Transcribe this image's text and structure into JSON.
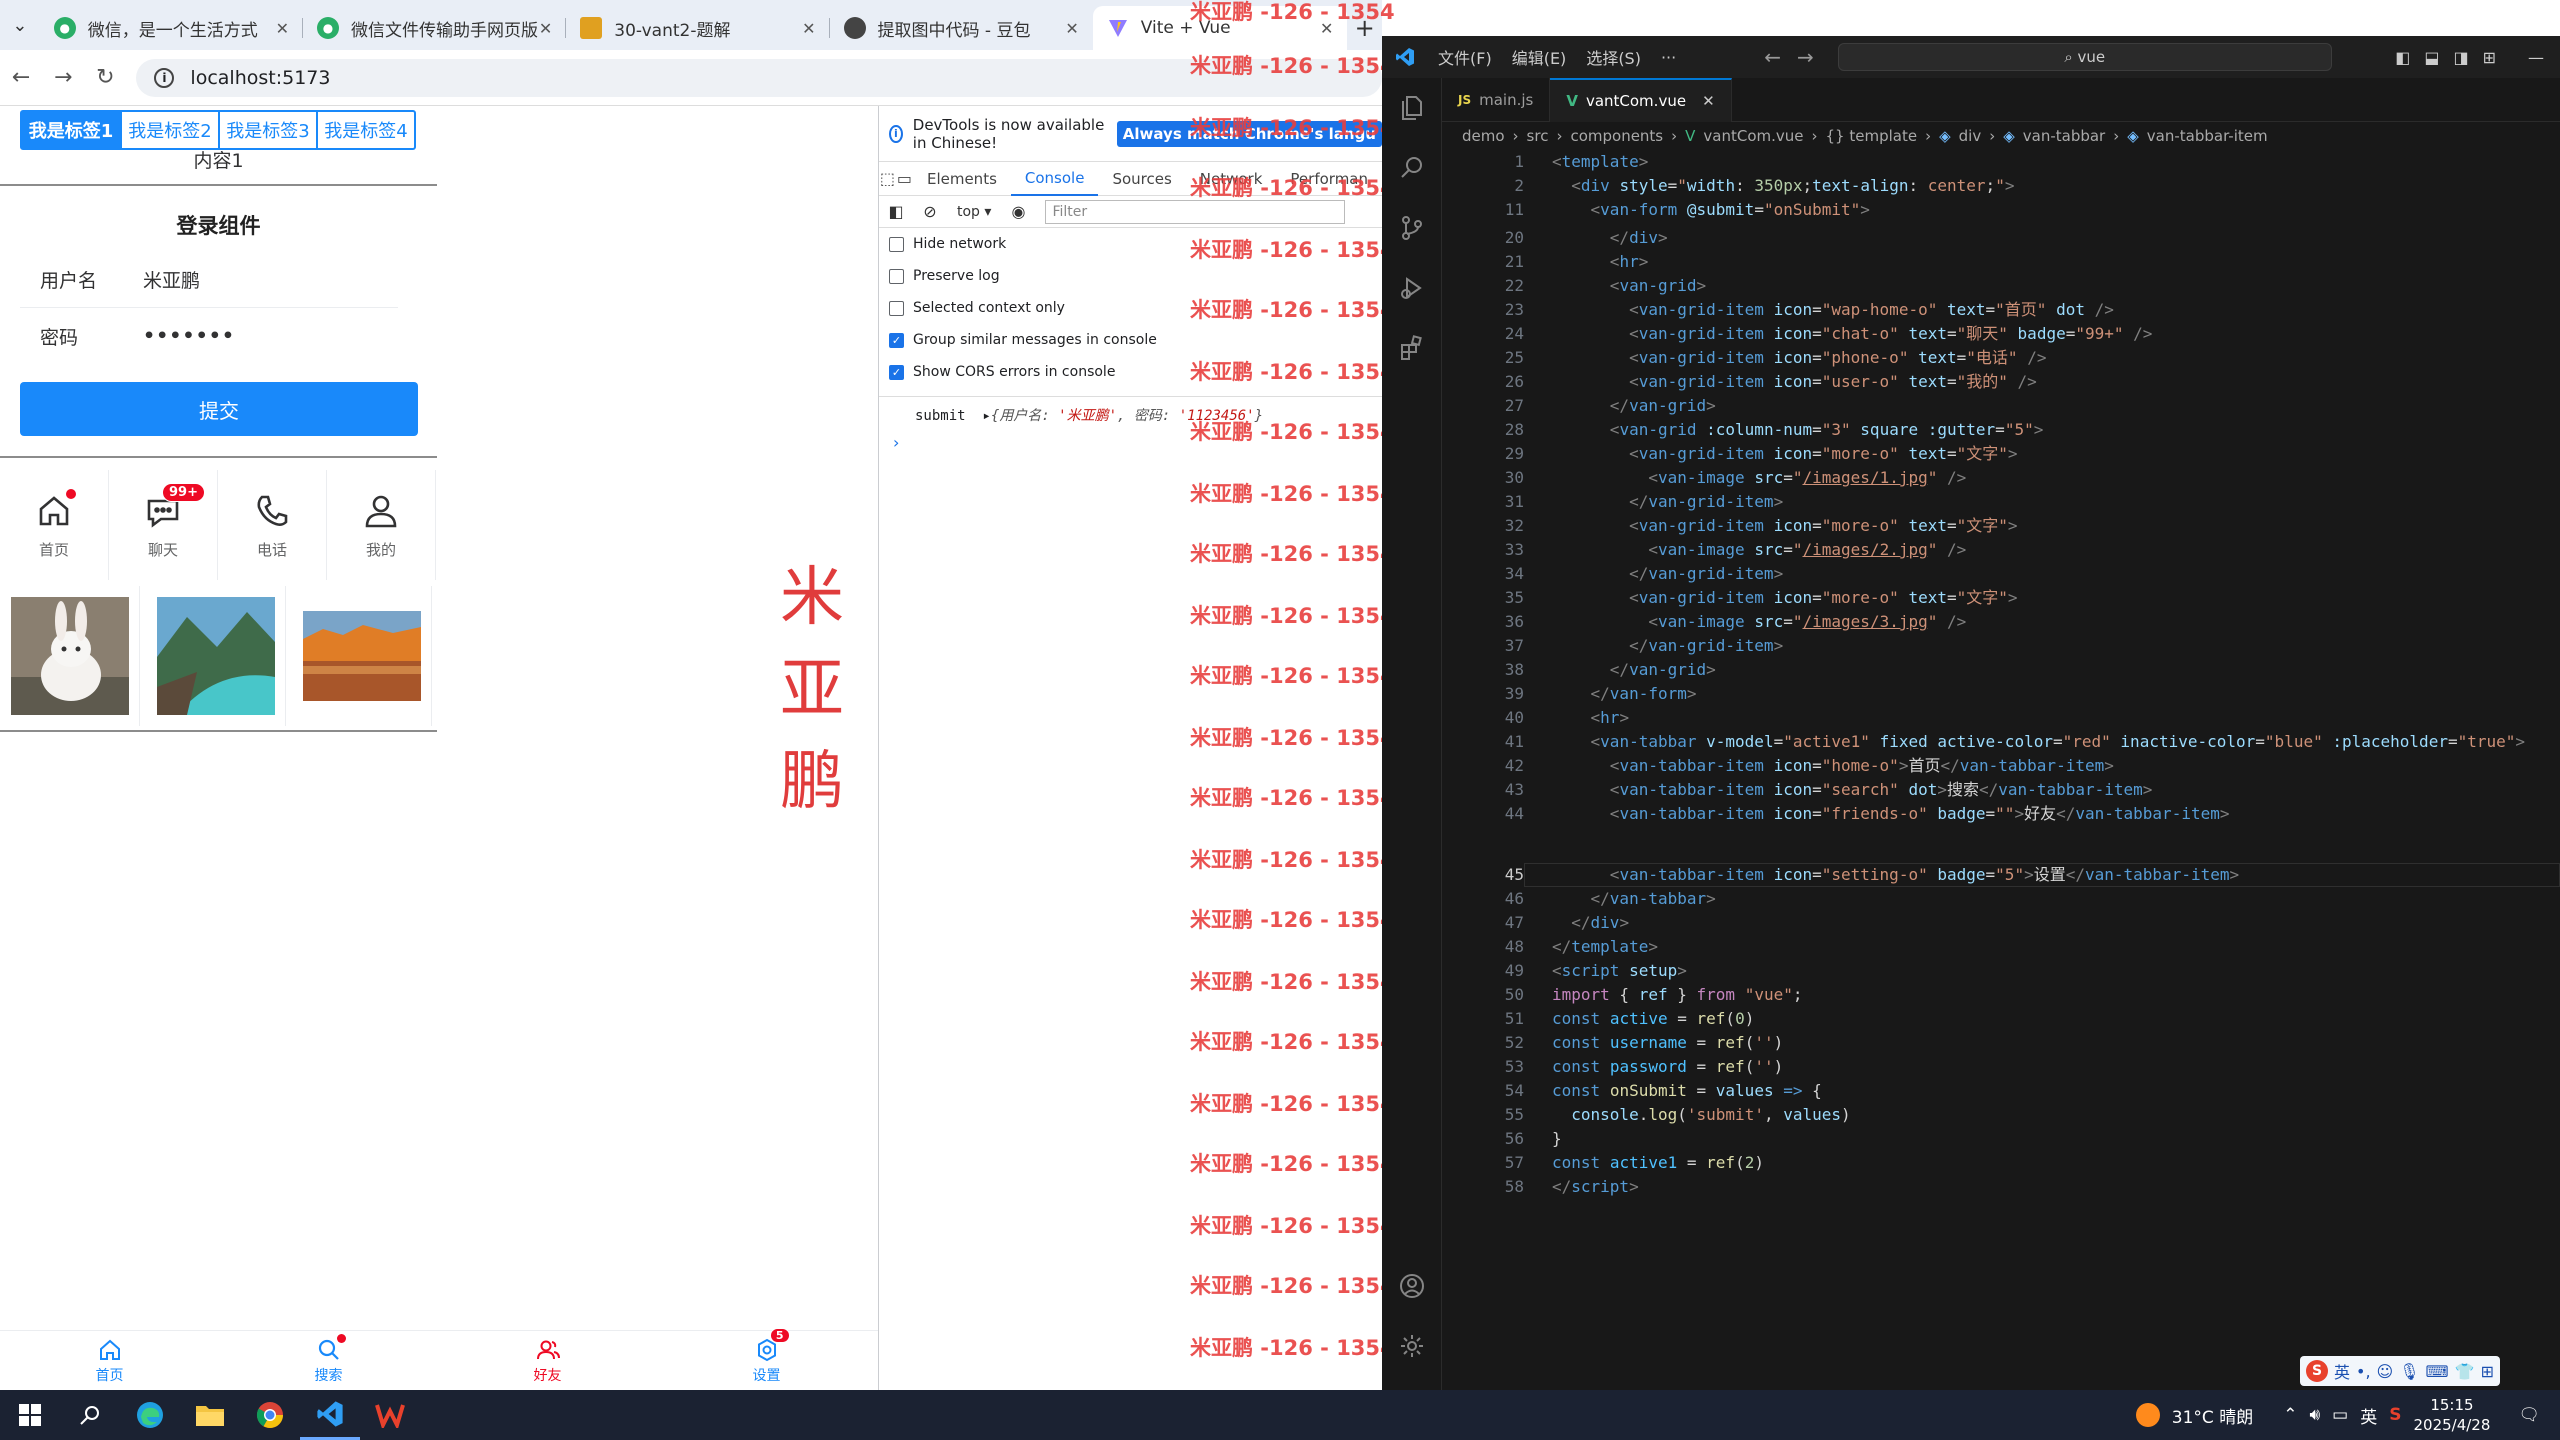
{
  "browser": {
    "tabs": [
      {
        "title": "微信，是一个生活方式",
        "icon": "wechat-icon",
        "active": false
      },
      {
        "title": "微信文件传输助手网页版",
        "icon": "wechat-icon",
        "active": false
      },
      {
        "title": "30-vant2-题解",
        "icon": "image-icon",
        "active": false
      },
      {
        "title": "提取图中代码 - 豆包",
        "icon": "doubao-icon",
        "active": false
      },
      {
        "title": "Vite + Vue",
        "icon": "vite-icon",
        "active": true
      }
    ],
    "url": "localhost:5173"
  },
  "app": {
    "tabs": [
      "我是标签1",
      "我是标签2",
      "我是标签3",
      "我是标签4"
    ],
    "content": "内容1",
    "form_title": "登录组件",
    "username_label": "用户名",
    "username_value": "米亚鹏",
    "password_label": "密码",
    "password_value": "•••••••",
    "submit_label": "提交",
    "grid": [
      {
        "text": "首页",
        "icon": "home-icon",
        "dot": true,
        "badge": ""
      },
      {
        "text": "聊天",
        "icon": "chat-icon",
        "dot": false,
        "badge": "99+"
      },
      {
        "text": "电话",
        "icon": "phone-icon",
        "dot": false,
        "badge": ""
      },
      {
        "text": "我的",
        "icon": "user-icon",
        "dot": false,
        "badge": ""
      }
    ],
    "watermark": "米亚鹏",
    "tabbar": [
      {
        "text": "首页",
        "icon": "home-icon",
        "color": "#1989fa"
      },
      {
        "text": "搜索",
        "icon": "search-icon",
        "color": "#1989fa",
        "dot": true
      },
      {
        "text": "好友",
        "icon": "friends-icon",
        "color": "#ee0a24"
      },
      {
        "text": "设置",
        "icon": "setting-icon",
        "color": "#1989fa",
        "badge": "5"
      }
    ]
  },
  "devtools": {
    "info": "DevTools is now available in Chinese!",
    "info_button": "Always match Chrome's langu",
    "tabs": [
      "Elements",
      "Console",
      "Sources",
      "Network",
      "Performan"
    ],
    "active_tab": "Console",
    "context": "top",
    "filter_placeholder": "Filter",
    "options": [
      {
        "label": "Hide network",
        "checked": false
      },
      {
        "label": "Preserve log",
        "checked": false
      },
      {
        "label": "Selected context only",
        "checked": false
      },
      {
        "label": "Group similar messages in console",
        "checked": true
      },
      {
        "label": "Show CORS errors in console",
        "checked": true
      }
    ],
    "log_prefix": "submit",
    "log_key1": "用户名",
    "log_val1": "'米亚鹏'",
    "log_key2": "密码",
    "log_val2": "'1123456'",
    "watermark": "米亚鹏 -126 - 1354"
  },
  "vscode": {
    "menus": [
      "文件(F)",
      "编辑(E)",
      "选择(S)",
      "···"
    ],
    "search": "vue",
    "tabs": [
      {
        "name": "main.js",
        "type": "JS"
      },
      {
        "name": "vantCom.vue",
        "type": "V"
      }
    ],
    "breadcrumbs": [
      "demo",
      "src",
      "components",
      "vantCom.vue",
      "{} template",
      "div",
      "van-tabbar",
      "van-tabbar-item"
    ],
    "current_line": "45"
  },
  "taskbar": {
    "weather": "31°C  晴朗",
    "ime": "英",
    "time": "15:15",
    "date": "2025/4/28"
  }
}
